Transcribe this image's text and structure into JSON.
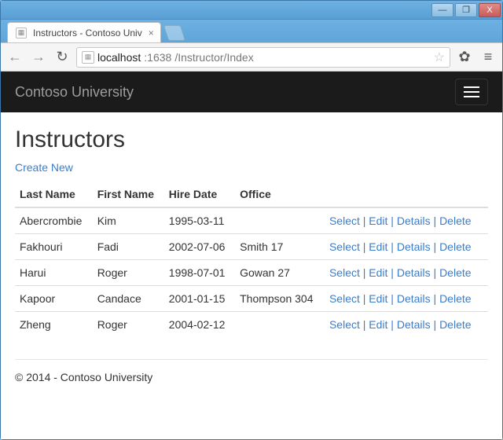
{
  "window": {
    "tab_title": "Instructors - Contoso Univ",
    "controls": {
      "min": "—",
      "max": "❐",
      "close": "X"
    }
  },
  "toolbar": {
    "back_glyph": "←",
    "forward_glyph": "→",
    "reload_glyph": "↻",
    "url_host": "localhost",
    "url_port": ":1638",
    "url_path": "/Instructor/Index",
    "star_glyph": "☆",
    "gear_glyph": "✿",
    "menu_glyph": "≡"
  },
  "navbar": {
    "brand": "Contoso University"
  },
  "page": {
    "heading": "Instructors",
    "create_label": "Create New",
    "columns": {
      "last_name": "Last Name",
      "first_name": "First Name",
      "hire_date": "Hire Date",
      "office": "Office",
      "actions": ""
    },
    "action_labels": {
      "select": "Select",
      "edit": "Edit",
      "details": "Details",
      "delete": "Delete",
      "sep": " | "
    },
    "rows": [
      {
        "last_name": "Abercrombie",
        "first_name": "Kim",
        "hire_date": "1995-03-11",
        "office": ""
      },
      {
        "last_name": "Fakhouri",
        "first_name": "Fadi",
        "hire_date": "2002-07-06",
        "office": "Smith 17"
      },
      {
        "last_name": "Harui",
        "first_name": "Roger",
        "hire_date": "1998-07-01",
        "office": "Gowan 27"
      },
      {
        "last_name": "Kapoor",
        "first_name": "Candace",
        "hire_date": "2001-01-15",
        "office": "Thompson 304"
      },
      {
        "last_name": "Zheng",
        "first_name": "Roger",
        "hire_date": "2004-02-12",
        "office": ""
      }
    ],
    "footer": "© 2014 - Contoso University"
  }
}
